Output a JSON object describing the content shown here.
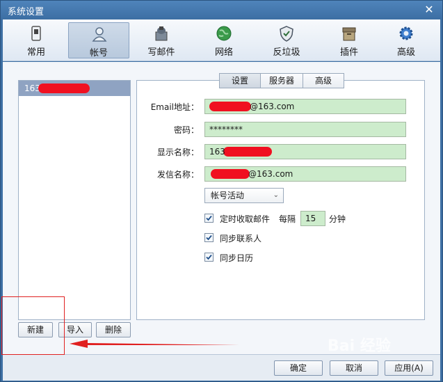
{
  "window": {
    "title": "系统设置"
  },
  "toolbar": {
    "items": [
      {
        "label": "常用",
        "icon": "phone-icon"
      },
      {
        "label": "帐号",
        "icon": "user-icon"
      },
      {
        "label": "写邮件",
        "icon": "mail-compose-icon"
      },
      {
        "label": "网络",
        "icon": "globe-icon"
      },
      {
        "label": "反垃圾",
        "icon": "shield-icon"
      },
      {
        "label": "插件",
        "icon": "plugin-box-icon"
      },
      {
        "label": "高级",
        "icon": "gear-icon"
      }
    ],
    "active": "帐号"
  },
  "accounts": {
    "items": [
      {
        "label": "163"
      }
    ],
    "buttons": {
      "new": "新建",
      "import": "导入",
      "delete": "删除"
    }
  },
  "tabs": [
    "设置",
    "服务器",
    "高级"
  ],
  "form": {
    "email_label": "Email地址：",
    "email_value": "@163.com",
    "password_label": "密码：",
    "password_value": "********",
    "display_label": "显示名称：",
    "display_value": "163",
    "sender_label": "发信名称：",
    "sender_value": "@163.com",
    "status_select": "帐号活动",
    "auto_receive_label": "定时收取邮件",
    "interval_prefix": "每隔",
    "interval_value": "15",
    "interval_unit": "分钟",
    "sync_contacts_label": "同步联系人",
    "sync_calendar_label": "同步日历"
  },
  "dialog_buttons": {
    "ok": "确定",
    "cancel": "取消",
    "apply": "应用(A)"
  },
  "watermark": "Bai 经验",
  "colors": {
    "field_bg": "#cdeccc",
    "title_bg": "#3c6ea3",
    "selection": "#8fa3c2",
    "annotation": "#e02020"
  }
}
